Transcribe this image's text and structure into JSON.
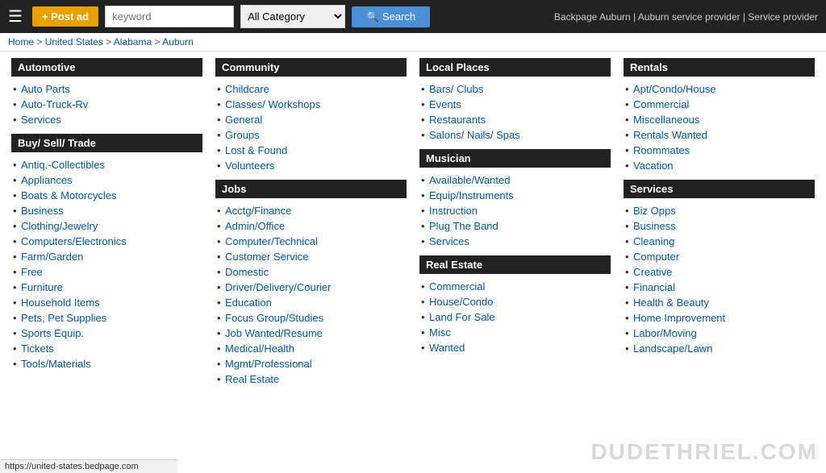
{
  "topbar": {
    "post_ad_label": "+ Post ad",
    "keyword_placeholder": "keyword",
    "category_default": "All Category",
    "search_label": "Search",
    "site_title": "Backpage Auburn | Auburn service provider | Service provider"
  },
  "breadcrumb": {
    "items": [
      "Home",
      "United States",
      "Alabama",
      "Auburn"
    ]
  },
  "columns": [
    {
      "sections": [
        {
          "header": "Automotive",
          "links": [
            "Auto Parts",
            "Auto-Truck-Rv",
            "Services"
          ]
        },
        {
          "header": "Buy/ Sell/ Trade",
          "links": [
            "Antiq.-Collectibles",
            "Appliances",
            "Boats & Motorcycles",
            "Business",
            "Clothing/Jewelry",
            "Computers/Electronics",
            "Farm/Garden",
            "Free",
            "Furniture",
            "Household Items",
            "Pets, Pet Supplies",
            "Sports Equip.",
            "Tickets",
            "Tools/Materials"
          ]
        }
      ]
    },
    {
      "sections": [
        {
          "header": "Community",
          "links": [
            "Childcare",
            "Classes/ Workshops",
            "General",
            "Groups",
            "Lost & Found",
            "Volunteers"
          ]
        },
        {
          "header": "Jobs",
          "links": [
            "Acctg/Finance",
            "Admin/Office",
            "Computer/Technical",
            "Customer Service",
            "Domestic",
            "Driver/Delivery/Courier",
            "Education",
            "Focus Group/Studies",
            "Job Wanted/Resume",
            "Medical/Health",
            "Mgmt/Professional",
            "Real Estate"
          ]
        }
      ]
    },
    {
      "sections": [
        {
          "header": "Local Places",
          "links": [
            "Bars/ Clubs",
            "Events",
            "Restaurants",
            "Salons/ Nails/ Spas"
          ]
        },
        {
          "header": "Musician",
          "links": [
            "Available/Wanted",
            "Equip/Instruments",
            "Instruction",
            "Plug The Band",
            "Services"
          ]
        },
        {
          "header": "Real Estate",
          "links": [
            "Commercial",
            "House/Condo",
            "Land For Sale",
            "Misc",
            "Wanted"
          ]
        }
      ]
    },
    {
      "sections": [
        {
          "header": "Rentals",
          "links": [
            "Apt/Condo/House",
            "Commercial",
            "Miscellaneous",
            "Rentals Wanted",
            "Roommates",
            "Vacation"
          ]
        },
        {
          "header": "Services",
          "links": [
            "Biz Opps",
            "Business",
            "Cleaning",
            "Computer",
            "Creative",
            "Financial",
            "Health & Beauty",
            "Home Improvement",
            "Labor/Moving",
            "Landscape/Lawn"
          ]
        }
      ]
    }
  ],
  "watermark": "DUDETHRIEL.COM",
  "status_bar": "https://united-states.bedpage.com"
}
